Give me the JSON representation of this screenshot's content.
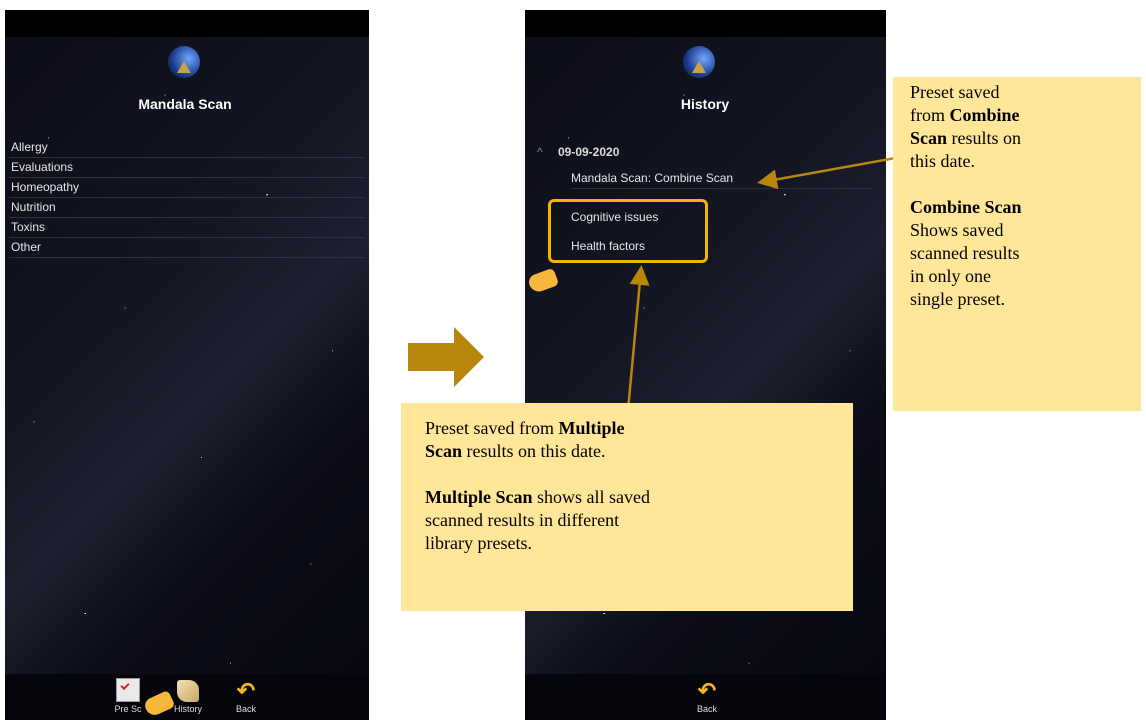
{
  "left_screen": {
    "title": "Mandala Scan",
    "categories": [
      "Allergy",
      "Evaluations",
      "Homeopathy",
      "Nutrition",
      "Toxins",
      "Other"
    ],
    "toolbar": {
      "preset_label": "Pre Sc",
      "history_label": "History",
      "back_label": "Back"
    }
  },
  "right_screen": {
    "title": "History",
    "date": "09-09-2020",
    "entries": [
      "Mandala Scan: Combine Scan",
      "Cognitive issues",
      "Health factors"
    ],
    "toolbar": {
      "back_label": "Back"
    }
  },
  "callouts": {
    "combine": {
      "line1_a": "Preset saved",
      "line2_a": "from ",
      "line2_b": "Combine",
      "line3_b": "Scan",
      "line3_a": " results on",
      "line4_a": "this date.",
      "title": "Combine Scan",
      "desc1": "Shows saved",
      "desc2": "scanned results",
      "desc3": "in only one",
      "desc4": "single preset."
    },
    "multiple": {
      "line1_a": "Preset saved from ",
      "line1_b": "Multiple",
      "line2_b": "Scan",
      "line2_a": " results on this date.",
      "title": "Multiple Scan",
      "desc1": " shows all saved",
      "desc2": "scanned results in different",
      "desc3": "library presets."
    }
  },
  "colors": {
    "callout_bg": "#ffe699",
    "accent": "#f5b400",
    "arrow": "#b8860b"
  }
}
